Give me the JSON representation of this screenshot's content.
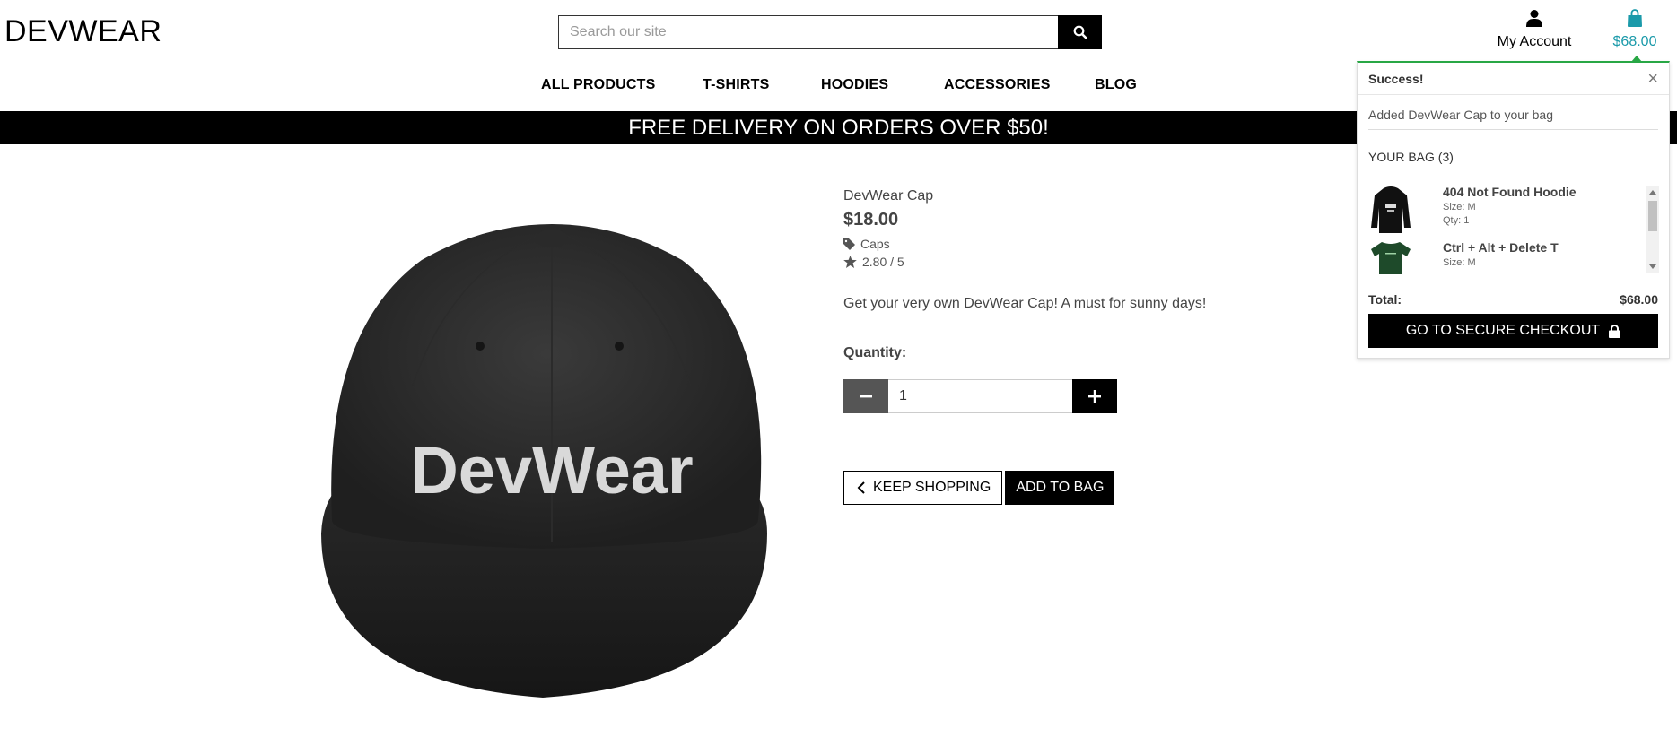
{
  "header": {
    "logo": "DEVWEAR",
    "search": {
      "placeholder": "Search our site"
    },
    "account_label": "My Account",
    "bag_total": "$68.00"
  },
  "nav": {
    "items": [
      {
        "label": "ALL PRODUCTS"
      },
      {
        "label": "T-SHIRTS"
      },
      {
        "label": "HOODIES"
      },
      {
        "label": "ACCESSORIES"
      },
      {
        "label": "BLOG"
      }
    ]
  },
  "banner": {
    "text": "FREE DELIVERY ON ORDERS OVER $50!"
  },
  "product": {
    "image_text": "DevWear",
    "name": "DevWear Cap",
    "price": "$18.00",
    "category": "Caps",
    "rating": "2.80 / 5",
    "description": "Get your very own DevWear Cap! A must for sunny days!",
    "quantity_label": "Quantity:",
    "quantity_value": "1",
    "keep_shopping": "KEEP SHOPPING",
    "add_to_bag": "ADD TO BAG"
  },
  "toast": {
    "title": "Success!",
    "close": "×",
    "message": "Added DevWear Cap to your bag",
    "bag_title": "YOUR BAG (3)",
    "items": [
      {
        "name": "404 Not Found Hoodie",
        "size": "Size: M",
        "qty": "Qty: 1"
      },
      {
        "name": "Ctrl + Alt + Delete T",
        "size": "Size: M"
      }
    ],
    "total_label": "Total:",
    "total_value": "$68.00",
    "checkout": "GO TO SECURE CHECKOUT"
  },
  "colors": {
    "accent": "#1b9aaa",
    "success": "#28a745",
    "black": "#000000"
  },
  "icons": {
    "search": "search-icon",
    "account": "user-icon",
    "bag": "shopping-bag-icon",
    "category": "tag-icon",
    "rating": "star-icon",
    "minus": "minus-icon",
    "plus": "plus-icon",
    "back": "chevron-left-icon",
    "lock": "lock-icon",
    "close": "close-icon"
  }
}
